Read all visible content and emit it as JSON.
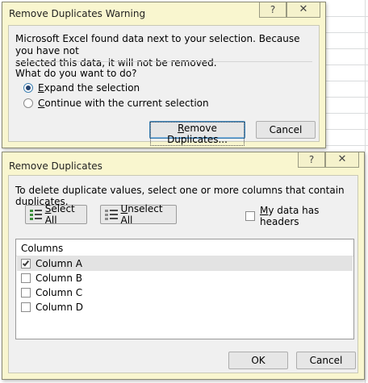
{
  "warning_dialog": {
    "title": "Remove Duplicates Warning",
    "help_icon": "question-mark-icon",
    "close_icon": "close-x-icon",
    "message_line1": "Microsoft Excel found data next to your selection. Because you have not",
    "message_line2": "selected this data, it will not be removed.",
    "question": "What do you want to do?",
    "options": [
      {
        "ak": "E",
        "rest": "xpand the selection",
        "selected": true
      },
      {
        "ak": "C",
        "rest": "ontinue with the current selection",
        "selected": false
      }
    ],
    "remove_button": {
      "ak": "R",
      "rest": "emove Duplicates..."
    },
    "cancel_label": "Cancel"
  },
  "remove_dialog": {
    "title": "Remove Duplicates",
    "help_icon": "question-mark-icon",
    "close_icon": "close-x-icon",
    "instruction": "To delete duplicate values, select one or more columns that contain duplicates.",
    "select_all": {
      "ak": "S",
      "rest": "elect All"
    },
    "unselect_all": {
      "ak": "U",
      "rest": "nselect All"
    },
    "headers_checkbox": {
      "ak": "M",
      "rest": "y data has headers",
      "checked": false
    },
    "columns_header": "Columns",
    "columns": [
      {
        "label": "Column A",
        "checked": true
      },
      {
        "label": "Column B",
        "checked": false
      },
      {
        "label": "Column C",
        "checked": false
      },
      {
        "label": "Column D",
        "checked": false
      }
    ],
    "ok_label": "OK",
    "cancel_label": "Cancel"
  },
  "colors": {
    "dialog_frame": "#f9f6cf",
    "content_bg": "#f0f0f0",
    "default_button_border": "#3c7fb1"
  }
}
